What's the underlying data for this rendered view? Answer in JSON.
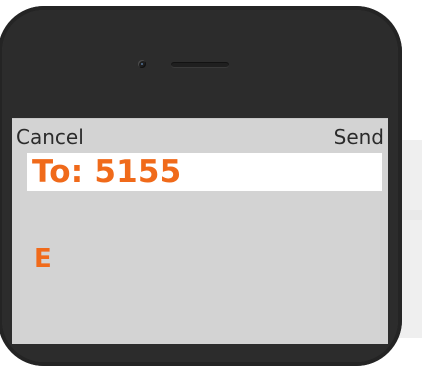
{
  "compose": {
    "cancel_label": "Cancel",
    "send_label": "Send",
    "to_text": "To: 5155",
    "message_text": "E"
  },
  "colors": {
    "accent": "#f06a1a",
    "screen_bg": "#d3d3d3",
    "phone_body": "#2c2c2c",
    "to_field_bg": "#ffffff"
  },
  "icons": {
    "camera": "camera-icon",
    "speaker": "speaker-grille"
  }
}
